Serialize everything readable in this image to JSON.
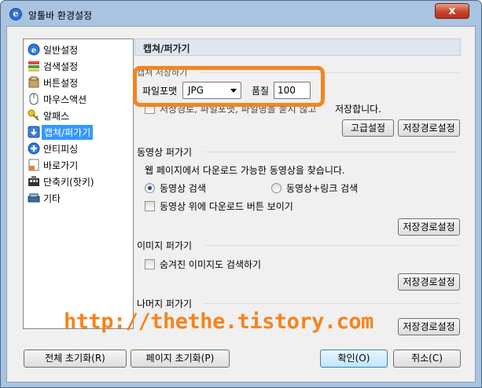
{
  "window": {
    "title": "알툴바 환경설정",
    "close_label": "x"
  },
  "sidebar": {
    "items": [
      {
        "label": "일반설정",
        "icon": "alttoolbar-icon"
      },
      {
        "label": "검색설정",
        "icon": "search-settings-icon"
      },
      {
        "label": "버튼설정",
        "icon": "buttons-icon"
      },
      {
        "label": "마우스액션",
        "icon": "mouse-icon"
      },
      {
        "label": "알패스",
        "icon": "key-icon"
      },
      {
        "label": "캡쳐/퍼가기",
        "icon": "capture-icon"
      },
      {
        "label": "안티피싱",
        "icon": "shield-icon"
      },
      {
        "label": "바로가기",
        "icon": "shortcut-icon"
      },
      {
        "label": "단축키(핫키)",
        "icon": "hotkey-icon"
      },
      {
        "label": "기타",
        "icon": "etc-icon"
      }
    ],
    "selected_index": 5
  },
  "header": {
    "title": "캡쳐/퍼가기"
  },
  "capture_save": {
    "group_label": "캡쳐 저장하기",
    "format_label": "파일포맷",
    "format_value": "JPG",
    "quality_label": "품질",
    "quality_value": "100",
    "auto_save_prefix": "저장경로, 파일포맷, 파일명을 묻지 않고",
    "auto_save_suffix": "저장합니다.",
    "advanced_button": "고급설정",
    "path_button": "저장경로설정"
  },
  "video": {
    "group_label": "동영상 퍼가기",
    "description": "웹 페이지에서 다운로드 가능한 동영상을 찾습니다.",
    "radio_video_search": "동영상 검색",
    "radio_video_link_search": "동영상+링크 검색",
    "show_download_button": "동영상 위에 다운로드 버튼 보이기",
    "path_button": "저장경로설정"
  },
  "image": {
    "group_label": "이미지 퍼가기",
    "search_hidden": "숨겨진 이미지도 검색하기",
    "path_button": "저장경로설정"
  },
  "rest": {
    "group_label": "나머지 퍼가기",
    "path_button": "저장경로설정"
  },
  "footer": {
    "reset_all": "전체 초기화(R)",
    "reset_page": "페이지 초기화(P)",
    "ok": "확인(O)",
    "cancel": "취소(C)"
  },
  "overlay": {
    "watermark": "http://thethe.tistory.com",
    "accent_color": "#f4841f"
  }
}
